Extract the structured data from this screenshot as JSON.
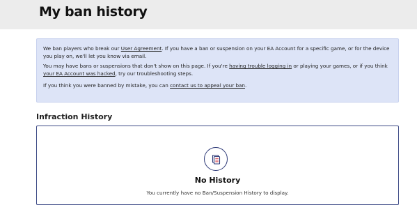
{
  "header": {
    "title": "My ban history"
  },
  "info": {
    "p1_pre": "We ban players who break our ",
    "p1_link": "User Agreement",
    "p1_post": ". If you have a ban or suspension on your EA Account for a specific game, or for the device you play on, we'll let you know via email.",
    "p2_pre": "You may have bans or suspensions that don't show on this page. If you're ",
    "p2_link1": "having trouble logging in",
    "p2_mid": " or playing your games, or if you think ",
    "p2_link2": "your EA Account was hacked",
    "p2_post": ", try our troubleshooting steps.",
    "p3_pre": "If you think you were banned by mistake, you can ",
    "p3_link": "contact us to appeal your ban",
    "p3_post": "."
  },
  "section": {
    "title": "Infraction History"
  },
  "history": {
    "icon": "document-list-icon",
    "empty_title": "No History",
    "empty_desc": "You currently have no Ban/Suspension History to display."
  },
  "colors": {
    "header_bg": "#ececec",
    "info_bg": "#dde4f7",
    "card_border": "#3d4a86",
    "icon_stroke": "#2e3a78"
  }
}
